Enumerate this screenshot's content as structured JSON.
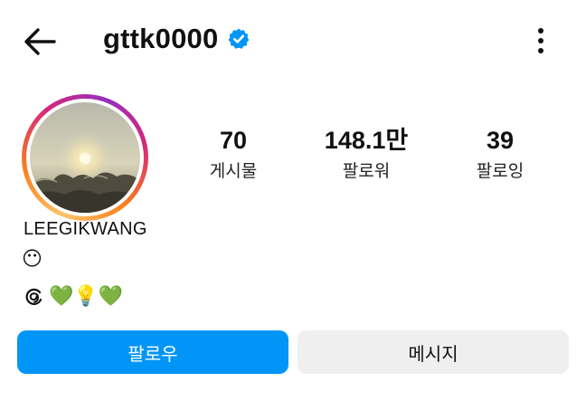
{
  "header": {
    "username": "gttk0000",
    "verified": true,
    "back_icon": "arrow-left-icon",
    "more_icon": "more-vertical-icon"
  },
  "profile": {
    "stats": {
      "posts_value": "70",
      "posts_label": "게시물",
      "followers_value": "148.1만",
      "followers_label": "팔로워",
      "following_value": "39",
      "following_label": "팔로잉"
    },
    "display_name": "LEEGIKWANG",
    "bio_line1": "😶",
    "bio_line2_emojis": "💚💡💚",
    "threads_icon": "threads-icon"
  },
  "actions": {
    "follow_label": "팔로우",
    "message_label": "메시지"
  },
  "colors": {
    "primary_button": "#0095f6",
    "secondary_button": "#efefef",
    "verified_badge": "#0095f6"
  }
}
